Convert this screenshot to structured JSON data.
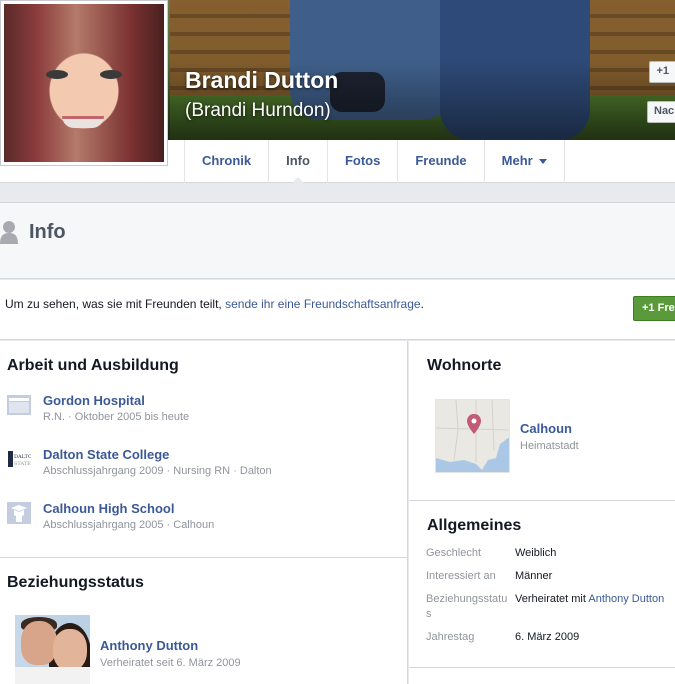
{
  "profile": {
    "name": "Brandi Dutton",
    "alternate_name": "(Brandi Hurndon)"
  },
  "cover_buttons": {
    "add_friend_label": "+1",
    "message_label": "Nac"
  },
  "tabs": [
    {
      "label": "Chronik"
    },
    {
      "label": "Info"
    },
    {
      "label": "Fotos"
    },
    {
      "label": "Freunde"
    },
    {
      "label": "Mehr"
    }
  ],
  "info_header": {
    "title": "Info"
  },
  "friend_request": {
    "text": "Um zu sehen, was sie mit Freunden teilt, ",
    "link": "sende ihr eine Freundschaftsanfrage",
    "suffix": ".",
    "button_label": "+1 Fre"
  },
  "work_education": {
    "title": "Arbeit und Ausbildung",
    "items": [
      {
        "name": "Gordon Hospital",
        "detail": "R.N. · Oktober 2005 bis heute",
        "logo_text": ""
      },
      {
        "name": "Dalton State College",
        "detail": "Abschlussjahrgang 2009 · Nursing RN · Dalton",
        "logo_text": "DALTON STATE"
      },
      {
        "name": "Calhoun High School",
        "detail": "Abschlussjahrgang 2005 · Calhoun",
        "logo_text": ""
      }
    ]
  },
  "relationship": {
    "title": "Beziehungsstatus",
    "partner": "Anthony Dutton",
    "detail": "Verheiratet seit 6. März 2009"
  },
  "places": {
    "title": "Wohnorte",
    "city": "Calhoun",
    "type": "Heimatstadt"
  },
  "general": {
    "title": "Allgemeines",
    "rows": [
      {
        "key": "Geschlecht",
        "value": "Weiblich"
      },
      {
        "key": "Interessiert an",
        "value": "Männer"
      },
      {
        "key": "Beziehungsstatus",
        "value_prefix": "Verheiratet mit ",
        "value_link": "Anthony Dutton"
      },
      {
        "key": "Jahrestag",
        "value": "6. März 2009"
      }
    ]
  },
  "colors": {
    "link": "#3b5998",
    "muted": "#90949c",
    "add_friend_green": "#5b9a3b",
    "page_bg": "#e9eaed"
  }
}
